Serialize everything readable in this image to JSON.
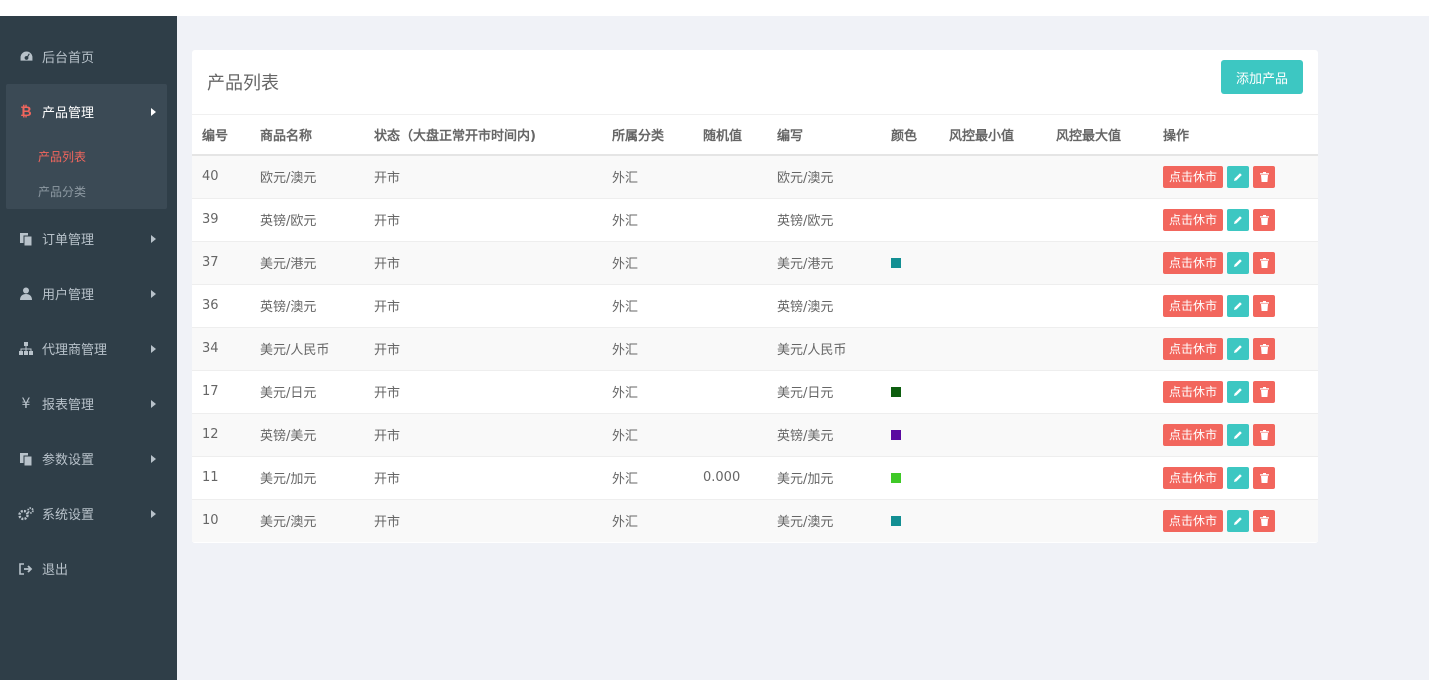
{
  "sidebar": {
    "items": [
      {
        "label": "后台首页",
        "icon": "dashboard-icon"
      },
      {
        "label": "产品管理",
        "icon": "bitcoin-icon",
        "open": true,
        "children": [
          {
            "label": "产品列表",
            "active": true
          },
          {
            "label": "产品分类"
          }
        ]
      },
      {
        "label": "订单管理",
        "icon": "copy-icon"
      },
      {
        "label": "用户管理",
        "icon": "user-icon"
      },
      {
        "label": "代理商管理",
        "icon": "sitemap-icon"
      },
      {
        "label": "报表管理",
        "icon": "yen-icon"
      },
      {
        "label": "参数设置",
        "icon": "copy-icon"
      },
      {
        "label": "系统设置",
        "icon": "gears-icon"
      },
      {
        "label": "退出",
        "icon": "sign-out-icon"
      }
    ]
  },
  "main": {
    "title": "产品列表",
    "add_button": "添加产品",
    "columns": [
      "编号",
      "商品名称",
      "状态（大盘正常开市时间内)",
      "所属分类",
      "随机值",
      "编写",
      "颜色",
      "风控最小值",
      "风控最大值",
      "操作"
    ],
    "rows": [
      {
        "id": "40",
        "name": "欧元/澳元",
        "status": "开市",
        "category": "外汇",
        "random": "",
        "code": "欧元/澳元",
        "color": ""
      },
      {
        "id": "39",
        "name": "英镑/欧元",
        "status": "开市",
        "category": "外汇",
        "random": "",
        "code": "英镑/欧元",
        "color": ""
      },
      {
        "id": "37",
        "name": "美元/港元",
        "status": "开市",
        "category": "外汇",
        "random": "",
        "code": "美元/港元",
        "color": "#138f93"
      },
      {
        "id": "36",
        "name": "英镑/澳元",
        "status": "开市",
        "category": "外汇",
        "random": "",
        "code": "英镑/澳元",
        "color": ""
      },
      {
        "id": "34",
        "name": "美元/人民币",
        "status": "开市",
        "category": "外汇",
        "random": "",
        "code": "美元/人民币",
        "color": ""
      },
      {
        "id": "17",
        "name": "美元/日元",
        "status": "开市",
        "category": "外汇",
        "random": "",
        "code": "美元/日元",
        "color": "#0d5e0f"
      },
      {
        "id": "12",
        "name": "英镑/美元",
        "status": "开市",
        "category": "外汇",
        "random": "",
        "code": "英镑/美元",
        "color": "#5a0aa0"
      },
      {
        "id": "11",
        "name": "美元/加元",
        "status": "开市",
        "category": "外汇",
        "random": "0.000",
        "code": "美元/加元",
        "color": "#3fc927"
      },
      {
        "id": "10",
        "name": "美元/澳元",
        "status": "开市",
        "category": "外汇",
        "random": "",
        "code": "美元/澳元",
        "color": "#138f93"
      }
    ],
    "row_actions": {
      "rest_label": "点击休市",
      "edit_icon": "pencil-icon",
      "delete_icon": "trash-icon"
    }
  },
  "colors": {
    "sidebar_bg": "#2f3e48",
    "accent_teal": "#3dc7c2",
    "accent_red": "#f2665d"
  }
}
